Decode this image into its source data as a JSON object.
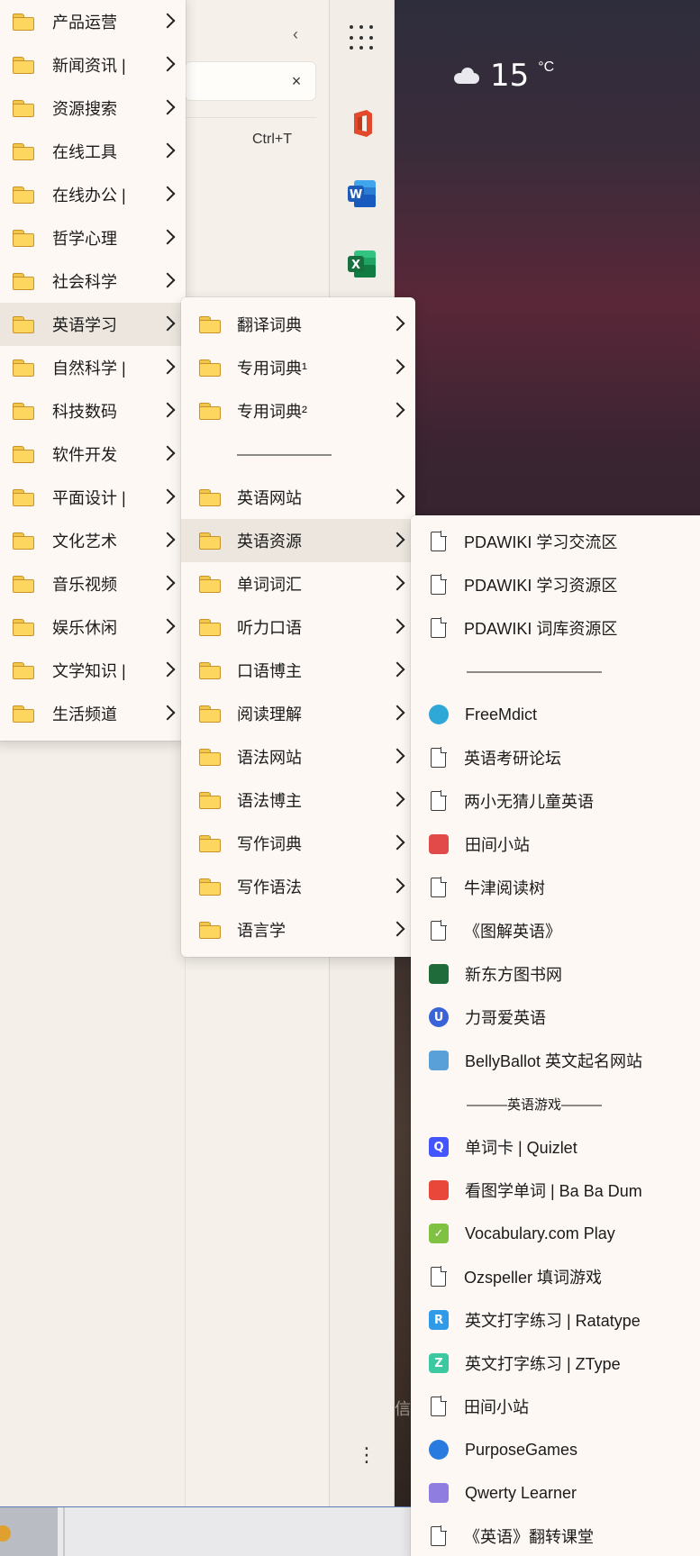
{
  "browser": {
    "shortcut": "Ctrl+T",
    "close_glyph": "×",
    "collapse_glyph": "‹"
  },
  "weather": {
    "temperature": "15",
    "unit": "°C",
    "icon": "cloud-icon"
  },
  "rail": {
    "items": [
      {
        "name": "apps-grid-icon"
      },
      {
        "name": "office-icon",
        "color": "#e2492a"
      },
      {
        "name": "word-icon",
        "color": "#1f5fb9",
        "letter": "W"
      },
      {
        "name": "excel-icon",
        "color": "#1e7a45",
        "letter": "X"
      }
    ],
    "more_glyph": "⋮"
  },
  "menu1": {
    "items": [
      {
        "label": "产品运营",
        "chev": true
      },
      {
        "label": "新闻资讯 |",
        "chev": true
      },
      {
        "label": "资源搜索",
        "chev": true
      },
      {
        "label": "在线工具",
        "chev": true
      },
      {
        "label": "在线办公 |",
        "chev": true
      },
      {
        "label": "哲学心理",
        "chev": true
      },
      {
        "label": "社会科学",
        "chev": true
      },
      {
        "label": "英语学习",
        "chev": true,
        "highlight": true
      },
      {
        "label": "自然科学 |",
        "chev": true
      },
      {
        "label": "科技数码",
        "chev": true
      },
      {
        "label": "软件开发",
        "chev": true
      },
      {
        "label": "平面设计 |",
        "chev": true
      },
      {
        "label": "文化艺术",
        "chev": true
      },
      {
        "label": "音乐视频",
        "chev": true
      },
      {
        "label": "娱乐休闲",
        "chev": true
      },
      {
        "label": "文学知识 |",
        "chev": true
      },
      {
        "label": "生活频道",
        "chev": true
      }
    ]
  },
  "menu2": {
    "items": [
      {
        "label": "翻译词典",
        "type": "folder"
      },
      {
        "label": "专用词典¹",
        "type": "folder"
      },
      {
        "label": "专用词典²",
        "type": "folder"
      },
      {
        "label": "———————",
        "type": "sep"
      },
      {
        "label": "英语网站",
        "type": "folder"
      },
      {
        "label": "英语资源",
        "type": "folder",
        "highlight": true
      },
      {
        "label": "单词词汇",
        "type": "folder"
      },
      {
        "label": "听力口语",
        "type": "folder"
      },
      {
        "label": "口语博主",
        "type": "folder"
      },
      {
        "label": "阅读理解",
        "type": "folder"
      },
      {
        "label": "语法网站",
        "type": "folder"
      },
      {
        "label": "语法博主",
        "type": "folder"
      },
      {
        "label": "写作词典",
        "type": "folder"
      },
      {
        "label": "写作语法",
        "type": "folder"
      },
      {
        "label": "语言学",
        "type": "folder"
      }
    ]
  },
  "menu3": {
    "items": [
      {
        "label": "PDAWIKI 学习交流区",
        "icon": "page-icon"
      },
      {
        "label": "PDAWIKI 学习资源区",
        "icon": "page-icon"
      },
      {
        "label": "PDAWIKI 词库资源区",
        "icon": "page-icon"
      },
      {
        "label": "——————————",
        "icon": "sep"
      },
      {
        "label": "FreeMdict",
        "icon": "freemdict-icon",
        "color": "#2fa8d8"
      },
      {
        "label": "英语考研论坛",
        "icon": "page-icon"
      },
      {
        "label": "两小无猜儿童英语",
        "icon": "page-icon"
      },
      {
        "label": "田间小站",
        "icon": "tractor-icon",
        "color": "#e24a4a"
      },
      {
        "label": "牛津阅读树",
        "icon": "page-icon"
      },
      {
        "label": "《图解英语》",
        "icon": "page-icon"
      },
      {
        "label": "新东方图书网",
        "icon": "shield-icon",
        "color": "#1f6b3a"
      },
      {
        "label": "力哥爱英语",
        "icon": "u-circle-icon",
        "color": "#3a63d8",
        "letter": "U"
      },
      {
        "label": "BellyBallot 英文起名网站",
        "icon": "stork-icon",
        "color": "#5aa0d8"
      },
      {
        "label": "———英语游戏———",
        "icon": "sep"
      },
      {
        "label": "单词卡 | Quizlet",
        "icon": "quizlet-icon",
        "color": "#4255ff",
        "letter": "Q"
      },
      {
        "label": "看图学单词 | Ba Ba Dum",
        "icon": "strawberry-icon",
        "color": "#e8473a"
      },
      {
        "label": "Vocabulary.com Play",
        "icon": "check-icon",
        "color": "#7fc241",
        "letter": "✓"
      },
      {
        "label": "Ozspeller 填词游戏",
        "icon": "page-icon"
      },
      {
        "label": "英文打字练习 | Ratatype",
        "icon": "ratatype-icon",
        "color": "#2f9be8",
        "letter": "R"
      },
      {
        "label": "英文打字练习 | ZType",
        "icon": "ztype-icon",
        "color": "#3cc8a0",
        "letter": "Z"
      },
      {
        "label": "田间小站",
        "icon": "page-icon"
      },
      {
        "label": "PurposeGames",
        "icon": "dot-icon",
        "color": "#2a7be0"
      },
      {
        "label": "Qwerty Learner",
        "icon": "keyboard-icon",
        "color": "#8f7ee0"
      },
      {
        "label": "《英语》翻转课堂",
        "icon": "page-icon"
      }
    ]
  },
  "wallpaper_text": "信"
}
